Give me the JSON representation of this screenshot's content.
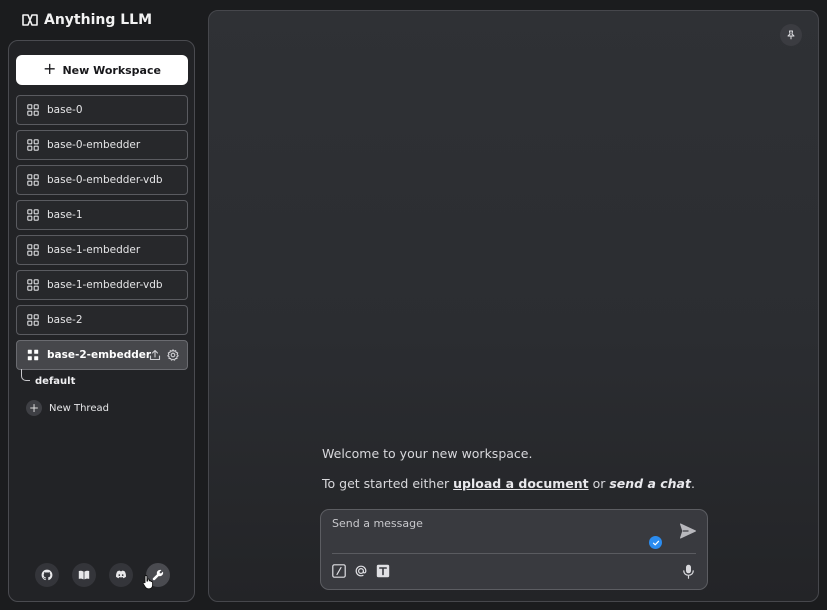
{
  "app": {
    "title": "Anything LLM"
  },
  "sidebar": {
    "new_workspace_label": "New Workspace",
    "workspaces": [
      {
        "label": "base-0"
      },
      {
        "label": "base-0-embedder"
      },
      {
        "label": "base-0-embedder-vdb"
      },
      {
        "label": "base-1"
      },
      {
        "label": "base-1-embedder"
      },
      {
        "label": "base-1-embedder-vdb"
      },
      {
        "label": "base-2"
      },
      {
        "label": "base-2-embedder",
        "active": true
      }
    ],
    "threads": [
      {
        "label": "default"
      }
    ],
    "new_thread_label": "New Thread",
    "footer_icons": [
      "github-icon",
      "book-icon",
      "discord-icon",
      "wrench-icon"
    ]
  },
  "main": {
    "welcome_text": "Welcome to your new workspace.",
    "get_started": {
      "prefix": "To get started either ",
      "upload_link": "upload a document",
      "middle": " or ",
      "chat_link": "send a chat",
      "suffix": "."
    },
    "composer": {
      "placeholder": "Send a message"
    }
  },
  "colors": {
    "background": "#1b1c1e",
    "accent_check": "#2b8cf0",
    "active_workspace": "#46474b"
  }
}
